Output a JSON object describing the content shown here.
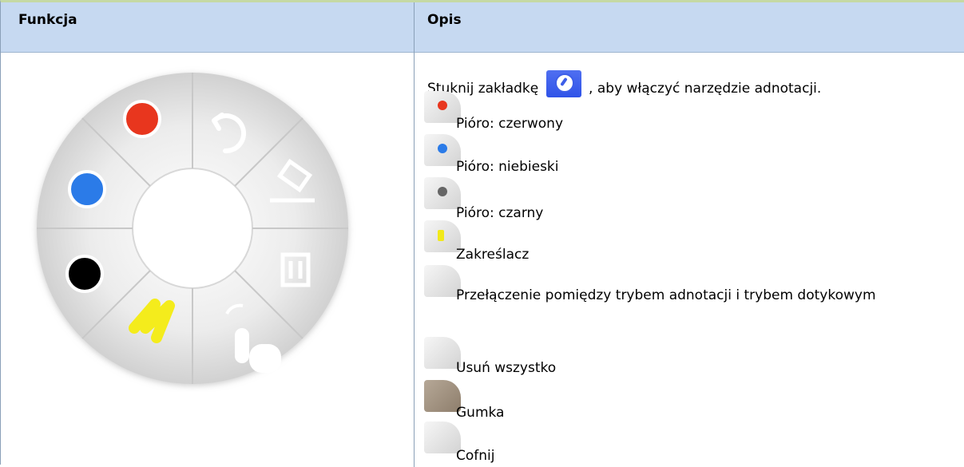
{
  "header": {
    "col1": "Funkcja",
    "col2": "Opis"
  },
  "intro": {
    "before": "Stuknij zakładkę",
    "after": ", aby włączyć narzędzie adnotacji.",
    "icon": "annotation-tab-icon"
  },
  "items": [
    {
      "label": "Pióro: czerwony",
      "icon": "red-pen-icon",
      "color": "#e8361e"
    },
    {
      "label": "Pióro: niebieski",
      "icon": "blue-pen-icon",
      "color": "#2b7be8"
    },
    {
      "label": "Pióro: czarny",
      "icon": "black-pen-icon",
      "color": "#666666"
    },
    {
      "label": "Zakreślacz",
      "icon": "highlighter-icon",
      "color": "#f1e91a"
    },
    {
      "label": "Przełączenie pomiędzy trybem adnotacji i trybem dotykowym",
      "icon": "touch-mode-icon",
      "color": ""
    },
    {
      "label": "Usuń wszystko",
      "icon": "trash-icon",
      "color": ""
    },
    {
      "label": "Gumka",
      "icon": "eraser-icon",
      "color": ""
    },
    {
      "label": "Cofnij",
      "icon": "undo-icon",
      "color": ""
    }
  ],
  "colors": {
    "header_bg": "#c6d9f1",
    "red": "#e8361e",
    "blue": "#2b7be8",
    "black": "#000000",
    "yellow": "#f4ec1c"
  }
}
